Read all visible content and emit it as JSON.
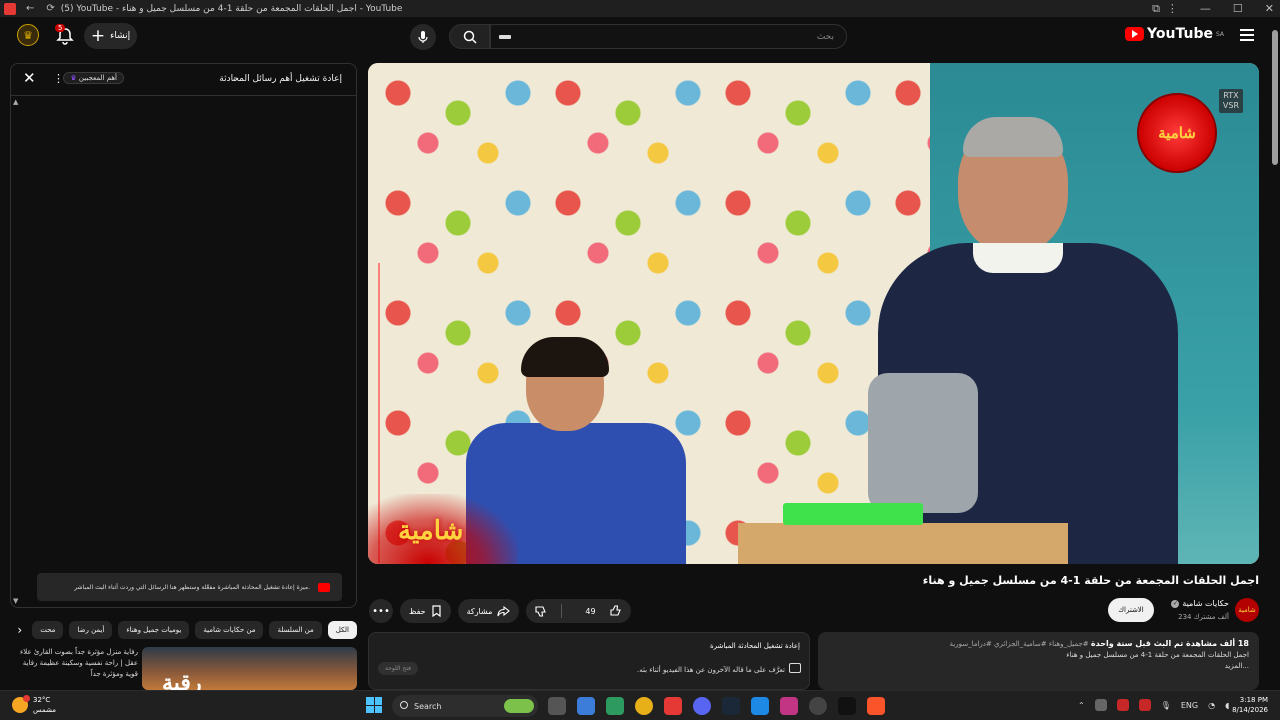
{
  "browser": {
    "tab_title": "(5) YouTube - اجمل الحلقات المجمعة من حلقة 1-4 من مسلسل جميل و هناء - YouTube"
  },
  "masthead": {
    "logo_text": "YouTube",
    "region": "SA",
    "search_placeholder": "بحث",
    "create_label": "إنشاء",
    "notification_count": "5"
  },
  "chat": {
    "title": "إعادة تشغيل أهم رسائل المحادثة",
    "top_fans_label": "أهم المعجبين",
    "banner_text": "ميزة إعادة تشغيل المحادثة المباشرة مفعّلة وستظهر هنا الرسائل التي وردت أثناء البث المباشر."
  },
  "chips": [
    "الكل",
    "من السلسلة",
    "من حكايات شامية",
    "يوميات جميل وهناء",
    "أيمن رضا",
    "محت"
  ],
  "recommendation": {
    "description": "رفاية منزل مؤثرة جداً بصوت القارئ علاء عقل | راحة نفسية وسكينة عظيمة رفاية قوية ومؤثرة جداً",
    "thumb_text": "رقية"
  },
  "player": {
    "rtx_label_line1": "RTX",
    "rtx_label_line2": "VSR",
    "channel_logo_text": "شامية",
    "watermark_text": "شامية"
  },
  "video": {
    "title": "اجمل الحلقات المجمعة من حلقة 1-4 من مسلسل جميل و هناء",
    "channel_name": "حكايات شامية",
    "channel_avatar_text": "شامية",
    "subscribers": "234 ألف مشترك",
    "subscribe_label": "الاشتراك",
    "likes": "49",
    "share_label": "مشاركة",
    "save_label": "حفظ"
  },
  "description": {
    "stats": "18 ألف مشاهدة  تم البث قبل سنة واحدة",
    "tags": "#جميل_وهناء #سامية_الجزائري #دراما_سورية",
    "line": "اجمل الحلقات المجمعة من حلقة 1-4 من مسلسل جميل و هناء",
    "more": "...المزيد"
  },
  "replay": {
    "title": "إعادة تشغيل المحادثة المباشرة",
    "text": "تعرَّف على ما قاله الآخرون عن هذا الفيديو أثناء بثه.",
    "button": "فتح اللوحة"
  },
  "taskbar": {
    "temperature": "32°C",
    "weather": "مشمس",
    "search_label": "Search",
    "lang": "ENG",
    "time": "3:18 PM",
    "date": "8/14/2026"
  }
}
